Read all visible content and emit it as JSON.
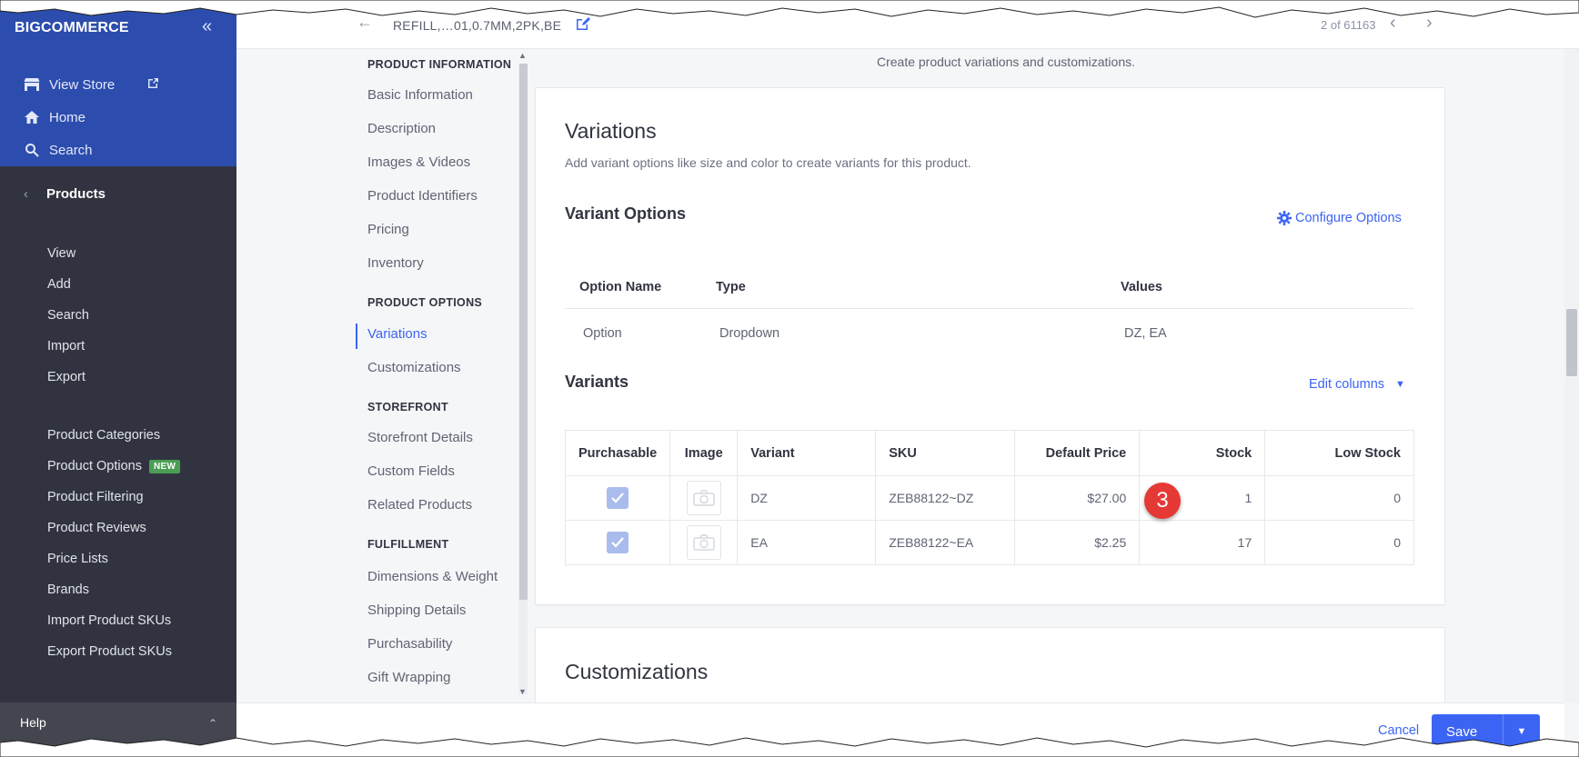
{
  "brand": {
    "logo_text": "BIGCOMMERCE"
  },
  "sidebar": {
    "top_links": [
      {
        "label": "View Store",
        "icon": "storefront-icon"
      },
      {
        "label": "Home",
        "icon": "home-icon"
      },
      {
        "label": "Search",
        "icon": "search-icon"
      }
    ],
    "section": "Products",
    "items": [
      "View",
      "Add",
      "Search",
      "Import",
      "Export"
    ],
    "items2": [
      "Product Categories",
      "Product Options",
      "Product Filtering",
      "Product Reviews",
      "Price Lists",
      "Brands",
      "Import Product SKUs",
      "Export Product SKUs"
    ],
    "new_badge": "NEW",
    "help": "Help"
  },
  "topbar": {
    "title": "REFILL,…01,0.7MM,2PK,BE",
    "pager": "2 of 61163"
  },
  "subnav": {
    "groups": [
      {
        "heading": "PRODUCT INFORMATION",
        "items": [
          "Basic Information",
          "Description",
          "Images & Videos",
          "Product Identifiers",
          "Pricing",
          "Inventory"
        ]
      },
      {
        "heading": "PRODUCT OPTIONS",
        "items": [
          "Variations",
          "Customizations"
        ]
      },
      {
        "heading": "STOREFRONT",
        "items": [
          "Storefront Details",
          "Custom Fields",
          "Related Products"
        ]
      },
      {
        "heading": "FULFILLMENT",
        "items": [
          "Dimensions & Weight",
          "Shipping Details",
          "Purchasability",
          "Gift Wrapping"
        ]
      }
    ],
    "active": "Variations"
  },
  "main": {
    "intro": "Create product variations and customizations.",
    "variations": {
      "title": "Variations",
      "subtitle": "Add variant options like size and color to create variants for this product.",
      "options_title": "Variant Options",
      "configure_label": "Configure Options",
      "options_headers": [
        "Option Name",
        "Type",
        "Values"
      ],
      "options_rows": [
        [
          "Option",
          "Dropdown",
          "DZ, EA"
        ]
      ],
      "variants_title": "Variants",
      "edit_columns_label": "Edit columns",
      "variant_headers": [
        "Purchasable",
        "Image",
        "Variant",
        "SKU",
        "Default Price",
        "Stock",
        "Low Stock"
      ],
      "variant_rows": [
        {
          "purchasable": true,
          "variant": "DZ",
          "sku": "ZEB88122~DZ",
          "price": "$27.00",
          "stock": "1",
          "low_stock": "0"
        },
        {
          "purchasable": true,
          "variant": "EA",
          "sku": "ZEB88122~EA",
          "price": "$2.25",
          "stock": "17",
          "low_stock": "0"
        }
      ]
    },
    "customizations": {
      "title": "Customizations"
    }
  },
  "callout": "3",
  "actions": {
    "cancel": "Cancel",
    "save": "Save"
  },
  "colors": {
    "accent": "#3c64f4",
    "sidebar_top": "#2c4dad",
    "sidebar": "#313440",
    "callout": "#e53935"
  }
}
